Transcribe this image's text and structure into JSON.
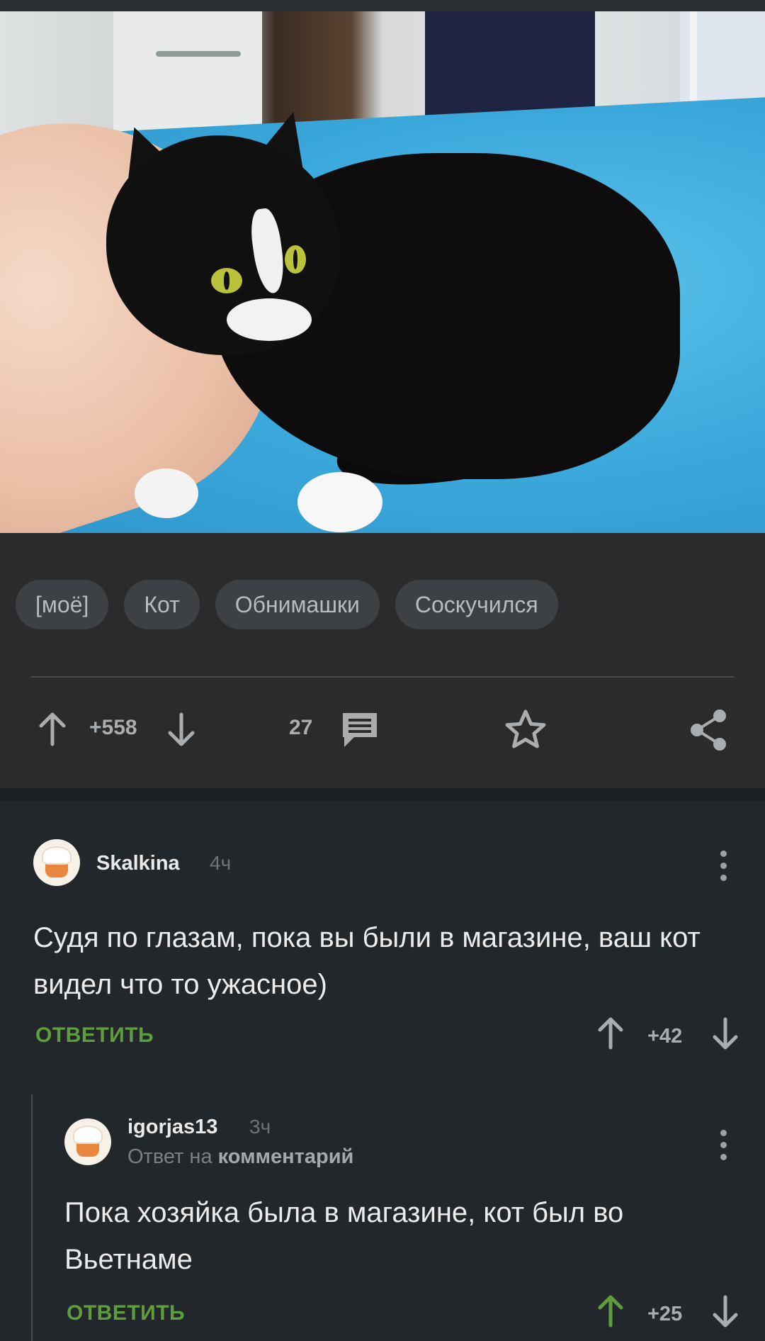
{
  "post": {
    "image_alt": "Чёрно-белый кот на голубом пледе",
    "tags": [
      "[моё]",
      "Кот",
      "Обнимашки",
      "Соскучился"
    ],
    "rating": "+558",
    "comments_count": "27"
  },
  "comments": [
    {
      "author": "Skalkina",
      "time": "4ч",
      "text": "Судя по глазам, пока вы были в магазине, ваш кот видел что то ужасное)",
      "reply_label": "ОТВЕТИТЬ",
      "rating": "+42"
    },
    {
      "author": "igorjas13",
      "time": "3ч",
      "reply_to_prefix": "Ответ на",
      "reply_to_target": "комментарий",
      "text": "Пока хозяйка была в магазине, кот был во Вьетнаме",
      "reply_label": "ОТВЕТИТЬ",
      "rating": "+25"
    }
  ],
  "colors": {
    "background": "#22272b",
    "panel": "#2b2b2b",
    "reply_green": "#5f9c3e",
    "upvoted_green": "#5f9c3e",
    "muted": "#a9adb0"
  },
  "icons": [
    "arrow-up-icon",
    "arrow-down-icon",
    "comments-icon",
    "star-icon",
    "share-icon",
    "more-vertical-icon",
    "avatar-chef-icon"
  ]
}
